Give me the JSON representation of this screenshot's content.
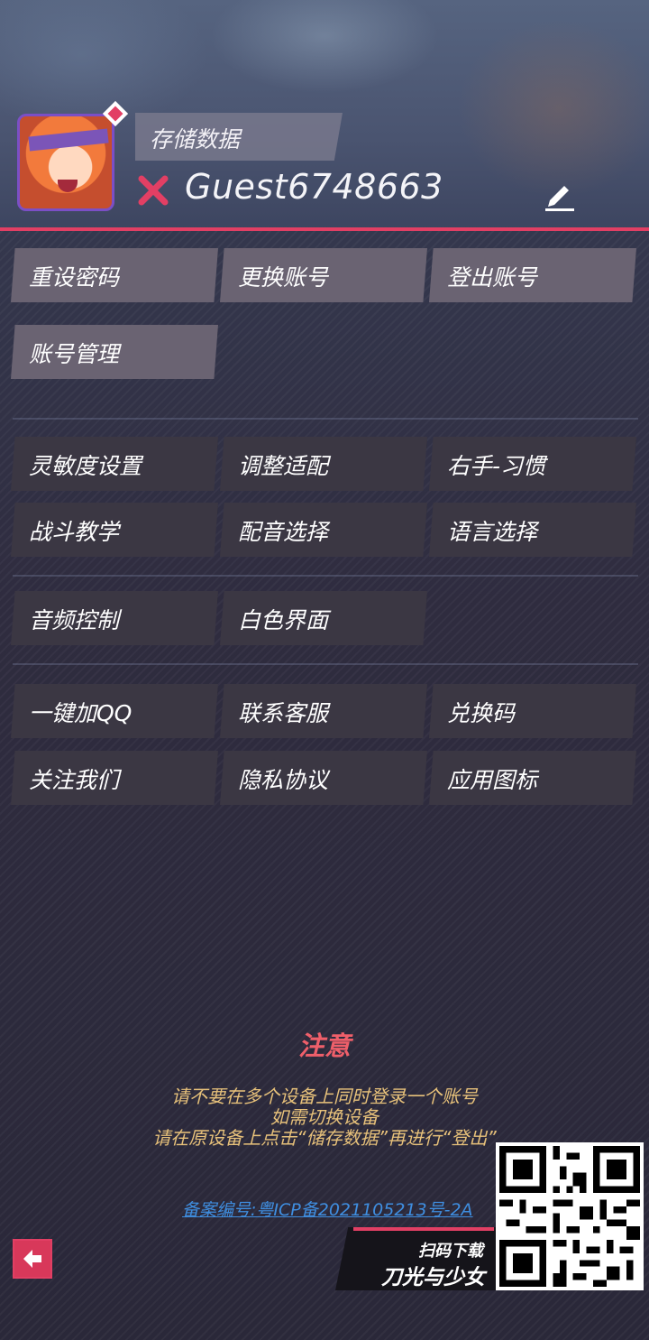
{
  "header": {
    "save_label": "存储数据",
    "username": "Guest6748663"
  },
  "account_buttons": [
    {
      "label": "重设密码"
    },
    {
      "label": "更换账号"
    },
    {
      "label": "登出账号"
    },
    {
      "label": "账号管理"
    }
  ],
  "settings_buttons": [
    {
      "label": "灵敏度设置"
    },
    {
      "label": "调整适配"
    },
    {
      "label": "右手-习惯"
    },
    {
      "label": "战斗教学"
    },
    {
      "label": "配音选择"
    },
    {
      "label": "语言选择"
    },
    {
      "label": "音频控制"
    },
    {
      "label": "白色界面"
    }
  ],
  "social_buttons": [
    {
      "label": "一键加QQ"
    },
    {
      "label": "联系客服"
    },
    {
      "label": "兑换码"
    },
    {
      "label": "关注我们"
    },
    {
      "label": "隐私协议"
    },
    {
      "label": "应用图标"
    }
  ],
  "notice": {
    "title": "注意",
    "lines": [
      "请不要在多个设备上同时登录一个账号",
      "如需切换设备",
      "请在原设备上点击“储存数据”再进行“登出”"
    ]
  },
  "icp_link": "备案编号:粤ICP备2021105213号-2A",
  "promo": {
    "scan_label": "扫码下载",
    "game_name": "刀光与少女"
  },
  "colors": {
    "accent": "#e23f64",
    "notice_text": "#e7c17a",
    "link": "#3f8ee0"
  },
  "icons": {
    "status": "close-icon",
    "edit": "pencil-icon",
    "back": "arrow-left-icon"
  }
}
